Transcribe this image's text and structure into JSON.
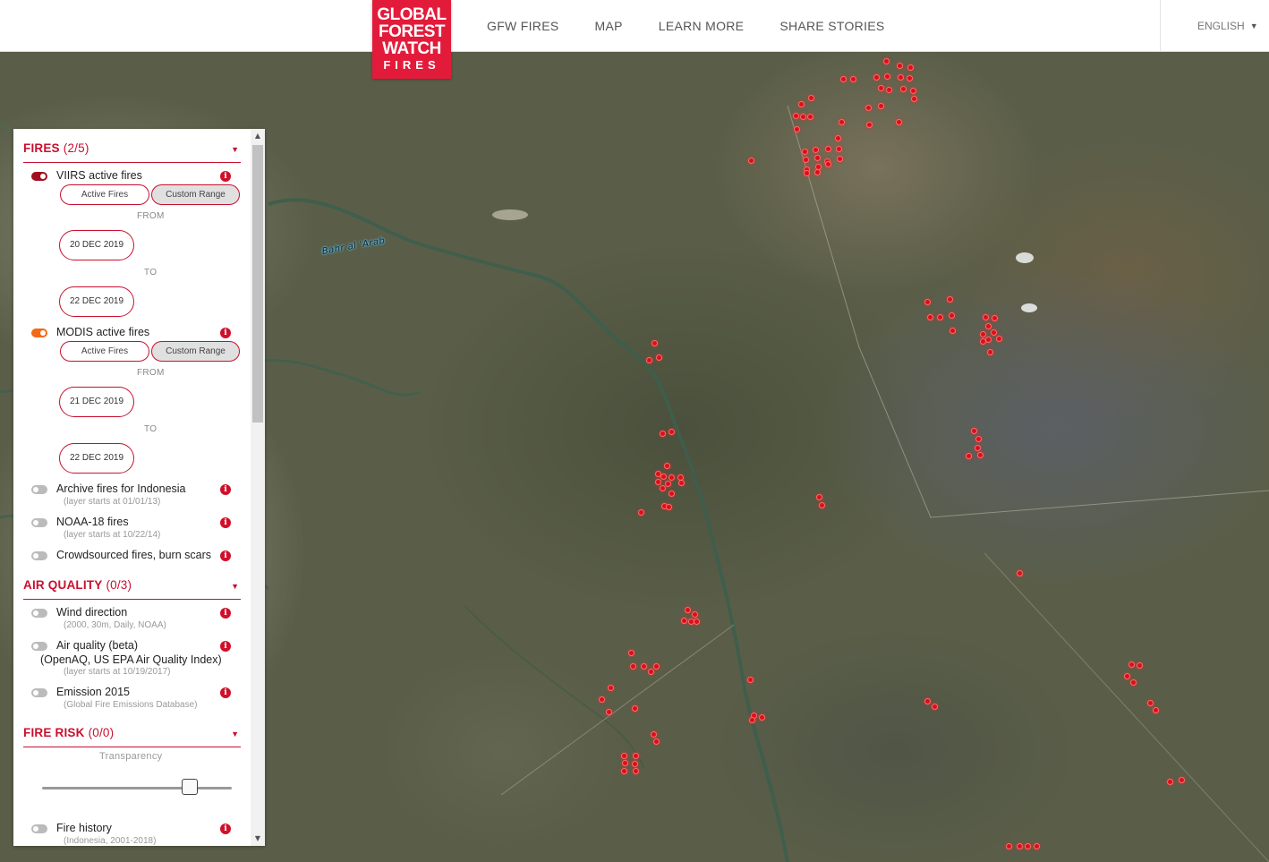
{
  "header": {
    "logo": {
      "line1": "GLOBAL",
      "line2": "FOREST",
      "line3": "WATCH",
      "line4": "FIRES"
    },
    "nav": [
      "GFW FIRES",
      "MAP",
      "LEARN MORE",
      "SHARE STORIES"
    ],
    "language": "ENGLISH",
    "brand_color": "#e31b3b"
  },
  "map": {
    "river_label": "Bahr al 'Arab",
    "fire_color": "#d8101c"
  },
  "panel": {
    "fires": {
      "title": "FIRES",
      "count": "(2/5)",
      "viirs": {
        "label": "VIIRS active fires",
        "tab_active": "Active Fires",
        "tab_custom": "Custom Range",
        "from_label": "FROM",
        "from_date": "20 DEC 2019",
        "to_label": "TO",
        "to_date": "22 DEC 2019"
      },
      "modis": {
        "label": "MODIS active fires",
        "tab_active": "Active Fires",
        "tab_custom": "Custom Range",
        "from_label": "FROM",
        "from_date": "21 DEC 2019",
        "to_label": "TO",
        "to_date": "22 DEC 2019"
      },
      "archive": {
        "label": "Archive fires for Indonesia",
        "sub": "(layer starts at 01/01/13)"
      },
      "noaa": {
        "label": "NOAA-18 fires",
        "sub": "(layer starts at 10/22/14)"
      },
      "crowd": {
        "label": "Crowdsourced fires, burn scars"
      }
    },
    "air_quality": {
      "title": "AIR QUALITY",
      "count": "(0/3)",
      "wind": {
        "label": "Wind direction",
        "sub": "(2000, 30m, Daily, NOAA)"
      },
      "aq": {
        "label": "Air quality (beta)",
        "sub_line": "(OpenAQ, US EPA Air Quality Index)",
        "sub": "(layer starts at 10/19/2017)"
      },
      "emission": {
        "label": "Emission 2015",
        "sub": "(Global Fire Emissions Database)"
      }
    },
    "fire_risk": {
      "title": "FIRE RISK",
      "count": "(0/0)",
      "transparency_label": "Transparency",
      "transparency": 0.78,
      "history": {
        "label": "Fire history",
        "sub": "(Indonesia, 2001-2018)"
      }
    },
    "info_icon": "i",
    "viirs_color": "#a01020",
    "modis_color": "#f26a16"
  }
}
